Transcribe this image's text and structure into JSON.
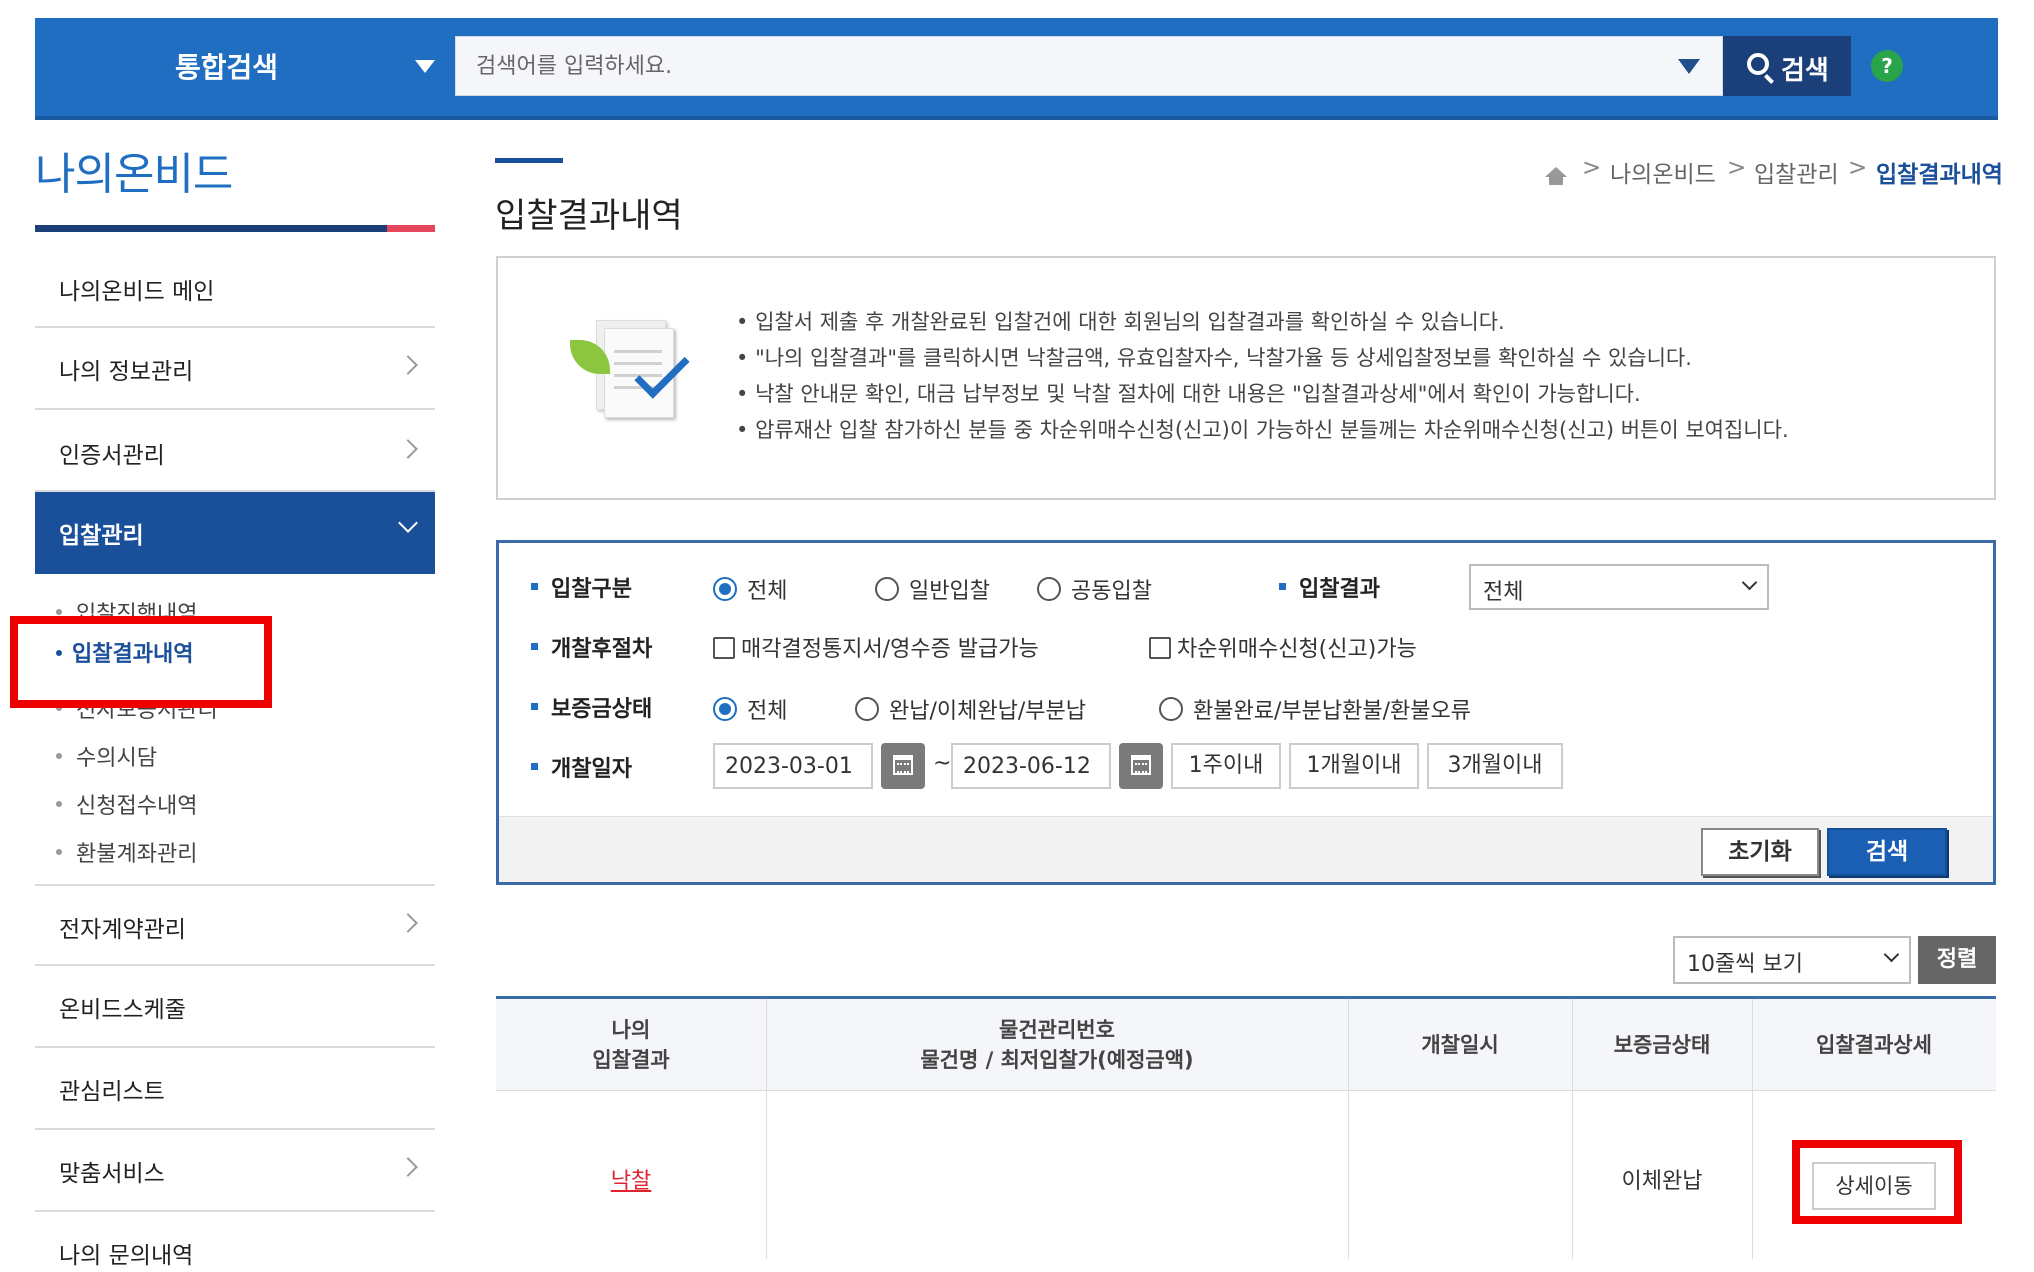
{
  "header": {
    "scope_label": "통합검색",
    "search_placeholder": "검색어를 입력하세요.",
    "search_button": "검색",
    "help_label": "?"
  },
  "sidebar": {
    "title": "나의온비드",
    "items": [
      {
        "label": "나의온비드 메인"
      },
      {
        "label": "나의 정보관리"
      },
      {
        "label": "인증서관리"
      },
      {
        "label": "입찰관리"
      },
      {
        "label": "전자계약관리"
      },
      {
        "label": "온비드스케줄"
      },
      {
        "label": "관심리스트"
      },
      {
        "label": "맞춤서비스"
      },
      {
        "label": "나의 문의내역"
      }
    ],
    "sub_items": [
      {
        "label": "입찰진행내역"
      },
      {
        "label": "입찰결과내역"
      },
      {
        "label": "전자보증서관리"
      },
      {
        "label": "수의시담"
      },
      {
        "label": "신청접수내역"
      },
      {
        "label": "환불계좌관리"
      }
    ]
  },
  "page": {
    "title": "입찰결과내역",
    "breadcrumb": [
      "나의온비드",
      "입찰관리",
      "입찰결과내역"
    ]
  },
  "info": [
    "입찰서 제출 후 개찰완료된 입찰건에 대한 회원님의 입찰결과를 확인하실 수 있습니다.",
    "\"나의 입찰결과\"를 클릭하시면 낙찰금액, 유효입찰자수, 낙찰가율 등 상세입찰정보를 확인하실 수 있습니다.",
    "낙찰 안내문 확인, 대금 납부정보 및 낙찰 절차에 대한 내용은 \"입찰결과상세\"에서 확인이 가능합니다.",
    "압류재산 입찰 참가하신 분들 중 차순위매수신청(신고)이 가능하신 분들께는 차순위매수신청(신고) 버튼이 보여집니다."
  ],
  "filter": {
    "bid_type_label": "입찰구분",
    "bid_type_options": [
      "전체",
      "일반입찰",
      "공동입찰"
    ],
    "bid_type_selected": "전체",
    "result_label": "입찰결과",
    "result_value": "전체",
    "post_label": "개찰후절차",
    "post_options": [
      "매각결정통지서/영수증 발급가능",
      "차순위매수신청(신고)가능"
    ],
    "deposit_label": "보증금상태",
    "deposit_options": [
      "전체",
      "완납/이체완납/부분납",
      "환불완료/부분납환불/환불오류"
    ],
    "deposit_selected": "전체",
    "date_label": "개찰일자",
    "date_from": "2023-03-01",
    "date_to": "2023-06-12",
    "date_sep": "~",
    "period_buttons": [
      "1주이내",
      "1개월이내",
      "3개월이내"
    ],
    "reset_button": "초기화",
    "search_button": "검색"
  },
  "list_controls": {
    "per_page": "10줄씩 보기",
    "sort_button": "정렬"
  },
  "table": {
    "headers": [
      [
        "나의",
        "입찰결과"
      ],
      [
        "물건관리번호",
        "물건명 / 최저입찰가(예정금액)"
      ],
      [
        "개찰일시"
      ],
      [
        "보증금상태"
      ],
      [
        "입찰결과상세"
      ]
    ],
    "rows": [
      {
        "result": "낙찰",
        "item": "",
        "open_date": "",
        "deposit_status": "이체완납",
        "detail_button": "상세이동"
      }
    ]
  },
  "colors": {
    "primary_blue": "#1f6ec1",
    "dark_blue": "#1a3f79",
    "highlight_red": "#ee0000",
    "win_red": "#e0242f"
  }
}
